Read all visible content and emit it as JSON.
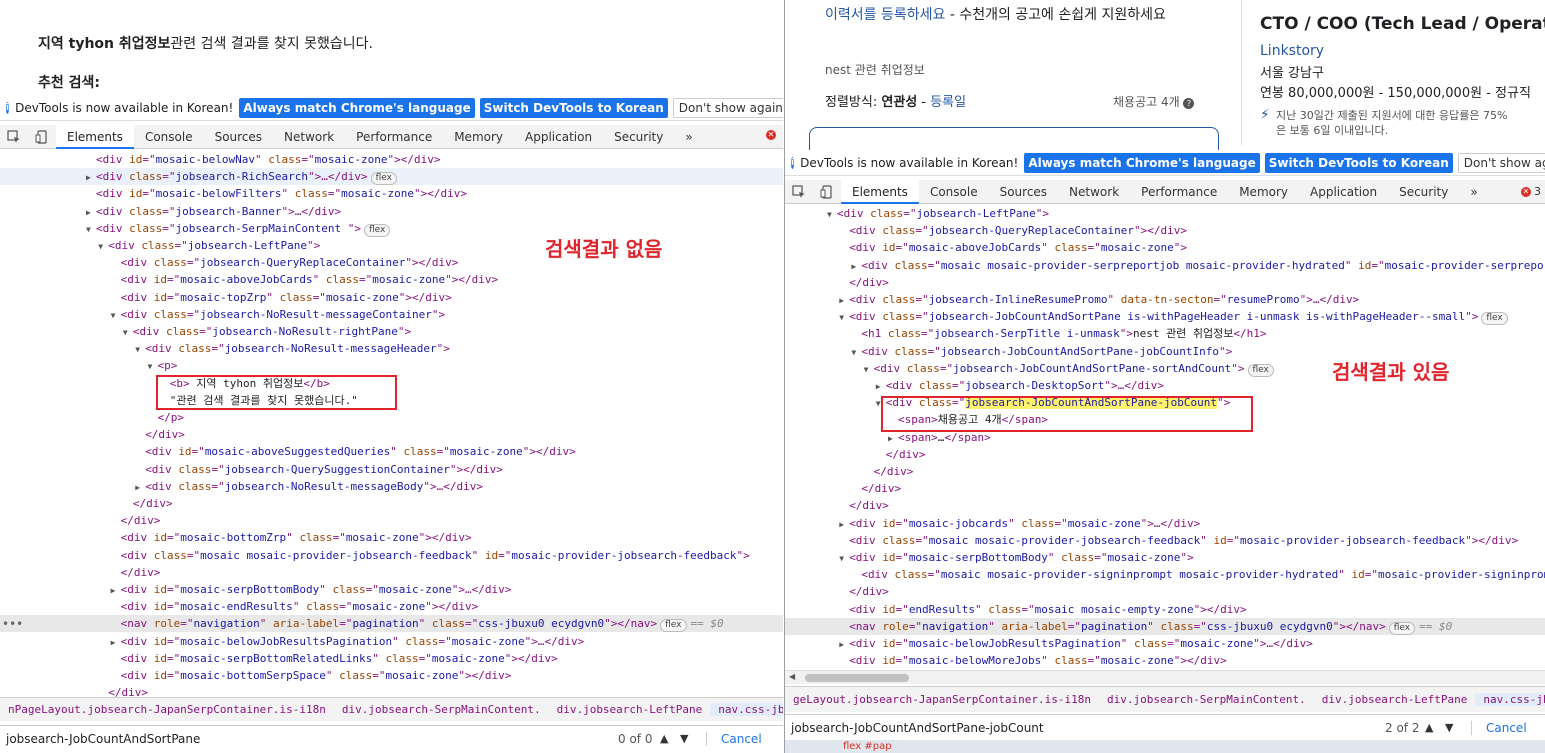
{
  "left": {
    "page": {
      "no_result_bold": "지역 tyhon 취업정보",
      "no_result_rest": "관련 검색 결과를 찾지 못했습니다.",
      "recommended_label": "추천 검색:"
    },
    "infobar": {
      "message": "DevTools is now available in Korean!",
      "btn_match": "Always match Chrome's language",
      "btn_switch": "Switch DevTools to Korean",
      "btn_dont_show": "Don't show again"
    },
    "tabs": [
      "Elements",
      "Console",
      "Sources",
      "Network",
      "Performance",
      "Memory",
      "Application",
      "Security",
      "»"
    ],
    "annotation": "검색결과 없음",
    "breadcrumbs": [
      "nPageLayout.jobsearch-JapanSerpContainer.is-i18n",
      "div.jobsearch-SerpMainContent.",
      "div.jobsearch-LeftPane",
      "nav.css-jbuxu0.ecydgvn0"
    ],
    "search": {
      "query": "jobsearch-JobCountAndSortPane",
      "count": "0 of 0",
      "cancel": "Cancel"
    },
    "tree": [
      {
        "ind": 0,
        "tri": "",
        "tag": "div",
        "attrs": [
          [
            "id",
            "mosaic-belowNav"
          ],
          [
            "class",
            "mosaic-zone"
          ]
        ],
        "close": "></div>"
      },
      {
        "ind": 0,
        "tri": "▶",
        "tag": "div",
        "attrs": [
          [
            "class",
            "jobsearch-RichSearch"
          ]
        ],
        "close": ">…</div>",
        "badge": "flex"
      },
      {
        "ind": 0,
        "tri": "",
        "tag": "div",
        "attrs": [
          [
            "id",
            "mosaic-belowFilters"
          ],
          [
            "class",
            "mosaic-zone"
          ]
        ],
        "close": "></div>"
      },
      {
        "ind": 0,
        "tri": "▶",
        "tag": "div",
        "attrs": [
          [
            "class",
            "jobsearch-Banner"
          ]
        ],
        "close": ">…</div>"
      },
      {
        "ind": 0,
        "tri": "▼",
        "tag": "div",
        "attrs": [
          [
            "class",
            "jobsearch-SerpMainContent "
          ]
        ],
        "close": ">",
        "badge": "flex"
      },
      {
        "ind": 1,
        "tri": "▼",
        "tag": "div",
        "attrs": [
          [
            "class",
            "jobsearch-LeftPane"
          ]
        ],
        "close": ">"
      },
      {
        "ind": 2,
        "tri": "",
        "tag": "div",
        "attrs": [
          [
            "class",
            "jobsearch-QueryReplaceContainer"
          ]
        ],
        "close": "></div>"
      },
      {
        "ind": 2,
        "tri": "",
        "tag": "div",
        "attrs": [
          [
            "id",
            "mosaic-aboveJobCards"
          ],
          [
            "class",
            "mosaic-zone"
          ]
        ],
        "close": "></div>"
      },
      {
        "ind": 2,
        "tri": "",
        "tag": "div",
        "attrs": [
          [
            "id",
            "mosaic-topZrp"
          ],
          [
            "class",
            "mosaic-zone"
          ]
        ],
        "close": "></div>"
      },
      {
        "ind": 2,
        "tri": "▼",
        "tag": "div",
        "attrs": [
          [
            "class",
            "jobsearch-NoResult-messageContainer"
          ]
        ],
        "close": ">"
      },
      {
        "ind": 3,
        "tri": "▼",
        "tag": "div",
        "attrs": [
          [
            "class",
            "jobsearch-NoResult-rightPane"
          ]
        ],
        "close": ">"
      },
      {
        "ind": 4,
        "tri": "▼",
        "tag": "div",
        "attrs": [
          [
            "class",
            "jobsearch-NoResult-messageHeader"
          ]
        ],
        "close": ">"
      },
      {
        "ind": 5,
        "tri": "▼",
        "raw": "<p>"
      },
      {
        "ind": 6,
        "tri": "",
        "raw": "<b> 지역 tyhon 취업정보</b>"
      },
      {
        "ind": 6,
        "tri": "",
        "text": "\"관련 검색 결과를 찾지 못했습니다.\""
      },
      {
        "ind": 5,
        "tri": "",
        "raw": "</p>"
      },
      {
        "ind": 4,
        "tri": "",
        "raw": "</div>"
      },
      {
        "ind": 4,
        "tri": "",
        "tag": "div",
        "attrs": [
          [
            "id",
            "mosaic-aboveSuggestedQueries"
          ],
          [
            "class",
            "mosaic-zone"
          ]
        ],
        "close": "></div>"
      },
      {
        "ind": 4,
        "tri": "",
        "tag": "div",
        "attrs": [
          [
            "class",
            "jobsearch-QuerySuggestionContainer"
          ]
        ],
        "close": "></div>"
      },
      {
        "ind": 4,
        "tri": "▶",
        "tag": "div",
        "attrs": [
          [
            "class",
            "jobsearch-NoResult-messageBody"
          ]
        ],
        "close": ">…</div>"
      },
      {
        "ind": 3,
        "tri": "",
        "raw": "</div>"
      },
      {
        "ind": 2,
        "tri": "",
        "raw": "</div>"
      },
      {
        "ind": 2,
        "tri": "",
        "tag": "div",
        "attrs": [
          [
            "id",
            "mosaic-bottomZrp"
          ],
          [
            "class",
            "mosaic-zone"
          ]
        ],
        "close": "></div>"
      },
      {
        "ind": 2,
        "tri": "",
        "tag": "div",
        "attrs": [
          [
            "class",
            "mosaic mosaic-provider-jobsearch-feedback"
          ],
          [
            "id",
            "mosaic-provider-jobsearch-feedback"
          ]
        ],
        "close": ">"
      },
      {
        "ind": 2,
        "tri": "",
        "raw": "</div>"
      },
      {
        "ind": 2,
        "tri": "▶",
        "tag": "div",
        "attrs": [
          [
            "id",
            "mosaic-serpBottomBody"
          ],
          [
            "class",
            "mosaic-zone"
          ]
        ],
        "close": ">…</div>"
      },
      {
        "ind": 2,
        "tri": "",
        "tag": "div",
        "attrs": [
          [
            "id",
            "mosaic-endResults"
          ],
          [
            "class",
            "mosaic-zone"
          ]
        ],
        "close": "></div>"
      },
      {
        "ind": 2,
        "tri": "",
        "tag": "nav",
        "attrs": [
          [
            "role",
            "navigation"
          ],
          [
            "aria-label",
            "pagination"
          ],
          [
            "class",
            "css-jbuxu0 ecydgvn0"
          ]
        ],
        "close": "></nav>",
        "badge": "flex",
        "dollar": "== $0",
        "sel": true
      },
      {
        "ind": 2,
        "tri": "▶",
        "tag": "div",
        "attrs": [
          [
            "id",
            "mosaic-belowJobResultsPagination"
          ],
          [
            "class",
            "mosaic-zone"
          ]
        ],
        "close": ">…</div>"
      },
      {
        "ind": 2,
        "tri": "",
        "tag": "div",
        "attrs": [
          [
            "id",
            "mosaic-serpBottomRelatedLinks"
          ],
          [
            "class",
            "mosaic-zone"
          ]
        ],
        "close": "></div>"
      },
      {
        "ind": 2,
        "tri": "",
        "tag": "div",
        "attrs": [
          [
            "id",
            "mosaic-bottomSerpSpace"
          ],
          [
            "class",
            "mosaic-zone"
          ]
        ],
        "close": "></div>"
      },
      {
        "ind": 1,
        "tri": "",
        "raw": "</div>"
      }
    ]
  },
  "right": {
    "page": {
      "register_link": "이력서를 등록하세요",
      "register_rest": " - 수천개의 공고에 손쉽게 지원하세요",
      "search_title": "nest 관련 취업정보",
      "sort_label": "정렬방식: ",
      "sort_current": "연관성",
      "sort_sep": " - ",
      "sort_date": "등록일",
      "job_count": "채용공고 4개",
      "job_title": "CTO / COO (Tech Lead / Operatio",
      "company": "Linkstory",
      "location": "서울 강남구",
      "salary": "연봉 80,000,000원 - 150,000,000원",
      "job_type": "- 정규직",
      "response_line1": "지난 30일간 제출된 지원서에 대한 응답률은 75%",
      "response_line2": "은 보통 6일 이내입니다."
    },
    "infobar": {
      "message": "DevTools is now available in Korean!",
      "btn_match": "Always match Chrome's language",
      "btn_switch": "Switch DevTools to Korean",
      "btn_dont_show": "Don't show again"
    },
    "tabs": [
      "Elements",
      "Console",
      "Sources",
      "Network",
      "Performance",
      "Memory",
      "Application",
      "Security",
      "»"
    ],
    "error_count": "3",
    "annotation": "검색결과 있음",
    "breadcrumbs": [
      "geLayout.jobsearch-JapanSerpContainer.is-i18n",
      "div.jobsearch-SerpMainContent.",
      "div.jobsearch-LeftPane",
      "nav.css-jbuxu0.ecydgvn0"
    ],
    "search": {
      "query": "jobsearch-JobCountAndSortPane-jobCount",
      "count": "2 of 2",
      "cancel": "Cancel"
    },
    "taskbar_text": "flex #pap",
    "tree": [
      {
        "ind": 0,
        "tri": "▼",
        "tag": "div",
        "attrs": [
          [
            "class",
            "jobsearch-LeftPane"
          ]
        ],
        "close": ">"
      },
      {
        "ind": 1,
        "tri": "",
        "tag": "div",
        "attrs": [
          [
            "class",
            "jobsearch-QueryReplaceContainer"
          ]
        ],
        "close": "></div>"
      },
      {
        "ind": 1,
        "tri": "",
        "tag": "div",
        "attrs": [
          [
            "id",
            "mosaic-aboveJobCards"
          ],
          [
            "class",
            "mosaic-zone"
          ]
        ],
        "close": ">"
      },
      {
        "ind": 2,
        "tri": "▶",
        "tag": "div",
        "attrs": [
          [
            "class",
            "mosaic mosaic-provider-serpreportjob mosaic-provider-hydrated"
          ],
          [
            "id",
            "mosaic-provider-serpreportjob"
          ]
        ],
        "close": ""
      },
      {
        "ind": 1,
        "tri": "",
        "raw": "</div>"
      },
      {
        "ind": 1,
        "tri": "▶",
        "tag": "div",
        "attrs": [
          [
            "class",
            "jobsearch-InlineResumePromo"
          ],
          [
            "data-tn-secton",
            "resumePromo"
          ]
        ],
        "close": ">…</div>"
      },
      {
        "ind": 1,
        "tri": "▼",
        "tag": "div",
        "attrs": [
          [
            "class",
            "jobsearch-JobCountAndSortPane is-withPageHeader i-unmask is-withPageHeader--small"
          ]
        ],
        "close": ">",
        "badge": "flex"
      },
      {
        "ind": 2,
        "tri": "",
        "tag": "h1",
        "attrs": [
          [
            "class",
            "jobsearch-SerpTitle i-unmask"
          ]
        ],
        "close": ">",
        "tail": "nest 관련 취업정보",
        "end": "</h1>"
      },
      {
        "ind": 2,
        "tri": "▼",
        "tag": "div",
        "attrs": [
          [
            "class",
            "jobsearch-JobCountAndSortPane-jobCountInfo"
          ]
        ],
        "close": ">"
      },
      {
        "ind": 3,
        "tri": "▼",
        "tag": "div",
        "attrs": [
          [
            "class",
            "jobsearch-JobCountAndSortPane-sortAndCount"
          ]
        ],
        "close": ">",
        "badge": "flex"
      },
      {
        "ind": 4,
        "tri": "▶",
        "tag": "div",
        "attrs": [
          [
            "class",
            "jobsearch-DesktopSort"
          ]
        ],
        "close": ">…</div>"
      },
      {
        "ind": 4,
        "tri": "▼",
        "tag": "div",
        "attrs": [
          [
            "class",
            "jobsearch-JobCountAndSortPane-jobCount"
          ]
        ],
        "close": ">",
        "hlattr": true
      },
      {
        "ind": 5,
        "tri": "",
        "raw": "<span>채용공고 4개</span>"
      },
      {
        "ind": 5,
        "tri": "▶",
        "raw": "<span>…</span>"
      },
      {
        "ind": 4,
        "tri": "",
        "raw": "</div>"
      },
      {
        "ind": 3,
        "tri": "",
        "raw": "</div>"
      },
      {
        "ind": 2,
        "tri": "",
        "raw": "</div>"
      },
      {
        "ind": 1,
        "tri": "",
        "raw": "</div>"
      },
      {
        "ind": 1,
        "tri": "▶",
        "tag": "div",
        "attrs": [
          [
            "id",
            "mosaic-jobcards"
          ],
          [
            "class",
            "mosaic-zone"
          ]
        ],
        "close": ">…</div>"
      },
      {
        "ind": 1,
        "tri": "",
        "tag": "div",
        "attrs": [
          [
            "class",
            "mosaic mosaic-provider-jobsearch-feedback"
          ],
          [
            "id",
            "mosaic-provider-jobsearch-feedback"
          ]
        ],
        "close": "></div>"
      },
      {
        "ind": 1,
        "tri": "▼",
        "tag": "div",
        "attrs": [
          [
            "id",
            "mosaic-serpBottomBody"
          ],
          [
            "class",
            "mosaic-zone"
          ]
        ],
        "close": ">"
      },
      {
        "ind": 2,
        "tri": "",
        "tag": "div",
        "attrs": [
          [
            "class",
            "mosaic mosaic-provider-signinprompt mosaic-provider-hydrated"
          ],
          [
            "id",
            "mosaic-provider-signinprompt"
          ]
        ],
        "close": ""
      },
      {
        "ind": 1,
        "tri": "",
        "raw": "</div>"
      },
      {
        "ind": 1,
        "tri": "",
        "tag": "div",
        "attrs": [
          [
            "id",
            "endResults"
          ],
          [
            "class",
            "mosaic mosaic-empty-zone"
          ]
        ],
        "close": "></div>"
      },
      {
        "ind": 1,
        "tri": "",
        "tag": "nav",
        "attrs": [
          [
            "role",
            "navigation"
          ],
          [
            "aria-label",
            "pagination"
          ],
          [
            "class",
            "css-jbuxu0 ecydgvn0"
          ]
        ],
        "close": "></nav>",
        "badge": "flex",
        "dollar": "== $0",
        "sel": true
      },
      {
        "ind": 1,
        "tri": "▶",
        "tag": "div",
        "attrs": [
          [
            "id",
            "mosaic-belowJobResultsPagination"
          ],
          [
            "class",
            "mosaic-zone"
          ]
        ],
        "close": ">…</div>"
      },
      {
        "ind": 1,
        "tri": "",
        "tag": "div",
        "attrs": [
          [
            "id",
            "mosaic-belowMoreJobs"
          ],
          [
            "class",
            "mosaic-zone"
          ]
        ],
        "close": "></div>"
      }
    ]
  }
}
